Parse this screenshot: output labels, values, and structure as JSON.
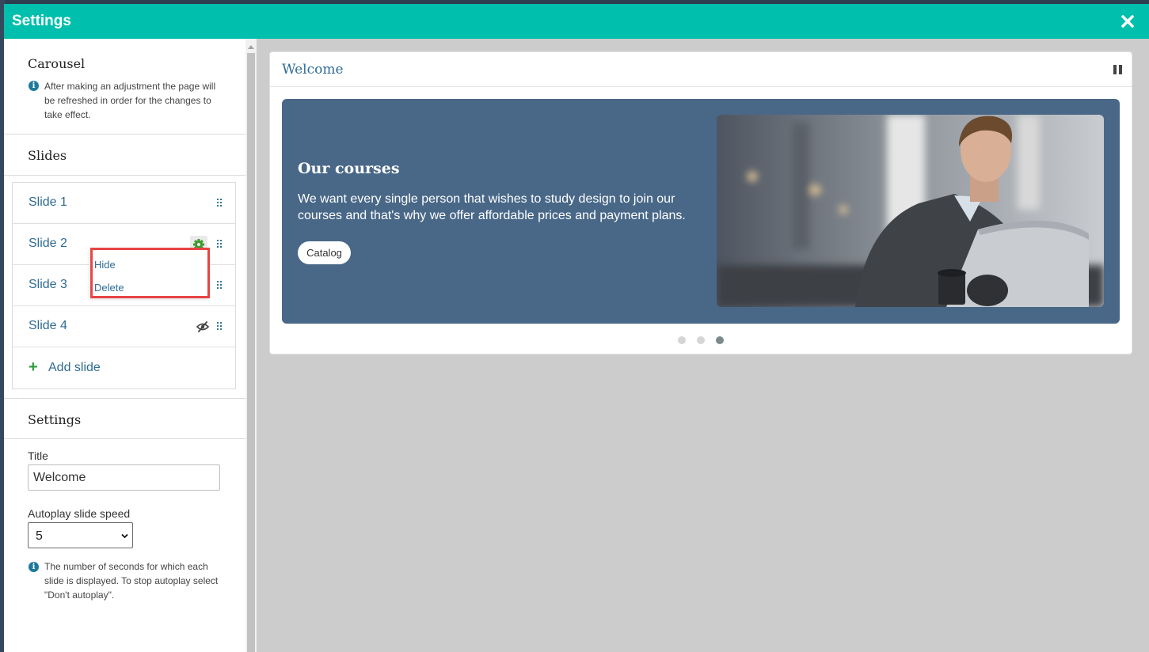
{
  "window": {
    "title": "Settings",
    "close_icon": "close-icon"
  },
  "sidebar": {
    "carousel": {
      "heading": "Carousel",
      "note": "After making an adjustment the page will be refreshed in order for the changes to take effect."
    },
    "slides": {
      "heading": "Slides",
      "items": [
        {
          "label": "Slide 1",
          "hidden": false
        },
        {
          "label": "Slide 2",
          "hidden": false,
          "menu_open": true
        },
        {
          "label": "Slide 3",
          "hidden": false
        },
        {
          "label": "Slide 4",
          "hidden": true
        }
      ],
      "add_label": "Add slide",
      "context_menu": {
        "hide": "Hide",
        "delete": "Delete"
      }
    },
    "settings": {
      "heading": "Settings",
      "title_label": "Title",
      "title_value": "Welcome",
      "speed_label": "Autoplay slide speed",
      "speed_value": "5",
      "speed_note": "The number of seconds for which each slide is displayed. To stop autoplay select \"Don't autoplay\"."
    }
  },
  "preview": {
    "card_title": "Welcome",
    "slide": {
      "heading": "Our courses",
      "text": "We want every single person that wishes to study design to join our courses and that's why we offer affordable prices and payment plans.",
      "button": "Catalog",
      "background": "#496888"
    },
    "dots": [
      {
        "active": false
      },
      {
        "active": false
      },
      {
        "active": true
      }
    ]
  },
  "colors": {
    "accent": "#00bfad",
    "link": "#2f6b94",
    "highlight": "#e84444"
  }
}
